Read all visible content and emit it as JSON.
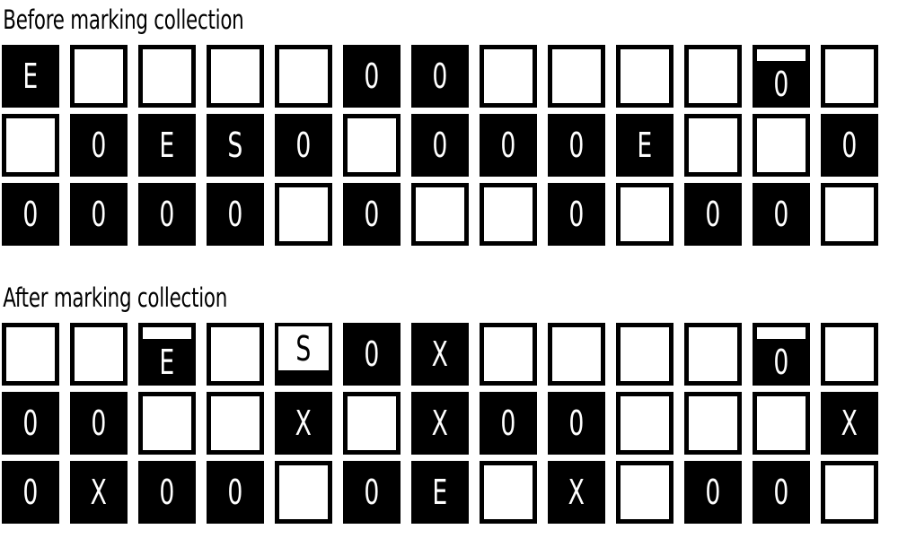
{
  "page": {
    "background_color": "#ffffff",
    "foreground_color": "#000000"
  },
  "sections": [
    {
      "id": "before",
      "title": "Before marking collection",
      "rows": [
        [
          {
            "state": "filled",
            "label": "E"
          },
          {
            "state": "empty",
            "label": ""
          },
          {
            "state": "empty",
            "label": ""
          },
          {
            "state": "empty",
            "label": ""
          },
          {
            "state": "empty",
            "label": ""
          },
          {
            "state": "filled",
            "label": "0"
          },
          {
            "state": "filled",
            "label": "0"
          },
          {
            "state": "empty",
            "label": ""
          },
          {
            "state": "empty",
            "label": ""
          },
          {
            "state": "empty",
            "label": ""
          },
          {
            "state": "empty",
            "label": ""
          },
          {
            "state": "marked",
            "label": "0"
          },
          {
            "state": "empty",
            "label": ""
          }
        ],
        [
          {
            "state": "empty",
            "label": ""
          },
          {
            "state": "filled",
            "label": "0"
          },
          {
            "state": "filled",
            "label": "E"
          },
          {
            "state": "filled",
            "label": "S"
          },
          {
            "state": "filled",
            "label": "0"
          },
          {
            "state": "empty",
            "label": ""
          },
          {
            "state": "filled",
            "label": "0"
          },
          {
            "state": "filled",
            "label": "0"
          },
          {
            "state": "filled",
            "label": "0"
          },
          {
            "state": "filled",
            "label": "E"
          },
          {
            "state": "empty",
            "label": ""
          },
          {
            "state": "empty",
            "label": ""
          },
          {
            "state": "filled",
            "label": "0"
          }
        ],
        [
          {
            "state": "filled",
            "label": "0"
          },
          {
            "state": "filled",
            "label": "0"
          },
          {
            "state": "filled",
            "label": "0"
          },
          {
            "state": "filled",
            "label": "0"
          },
          {
            "state": "empty",
            "label": ""
          },
          {
            "state": "filled",
            "label": "0"
          },
          {
            "state": "empty",
            "label": ""
          },
          {
            "state": "empty",
            "label": ""
          },
          {
            "state": "filled",
            "label": "0"
          },
          {
            "state": "empty",
            "label": ""
          },
          {
            "state": "filled",
            "label": "0"
          },
          {
            "state": "filled",
            "label": "0"
          },
          {
            "state": "empty",
            "label": ""
          }
        ]
      ]
    },
    {
      "id": "after",
      "title": "After marking collection",
      "rows": [
        [
          {
            "state": "empty",
            "label": ""
          },
          {
            "state": "empty",
            "label": ""
          },
          {
            "state": "marked",
            "label": "E"
          },
          {
            "state": "empty",
            "label": ""
          },
          {
            "state": "inverted",
            "label": "S"
          },
          {
            "state": "filled",
            "label": "0"
          },
          {
            "state": "filled",
            "label": "X"
          },
          {
            "state": "empty",
            "label": ""
          },
          {
            "state": "empty",
            "label": ""
          },
          {
            "state": "empty",
            "label": ""
          },
          {
            "state": "empty",
            "label": ""
          },
          {
            "state": "marked",
            "label": "0"
          },
          {
            "state": "empty",
            "label": ""
          }
        ],
        [
          {
            "state": "filled",
            "label": "0"
          },
          {
            "state": "filled",
            "label": "0"
          },
          {
            "state": "empty",
            "label": ""
          },
          {
            "state": "empty",
            "label": ""
          },
          {
            "state": "filled",
            "label": "X"
          },
          {
            "state": "empty",
            "label": ""
          },
          {
            "state": "filled",
            "label": "X"
          },
          {
            "state": "filled",
            "label": "0"
          },
          {
            "state": "filled",
            "label": "0"
          },
          {
            "state": "empty",
            "label": ""
          },
          {
            "state": "empty",
            "label": ""
          },
          {
            "state": "empty",
            "label": ""
          },
          {
            "state": "filled",
            "label": "X"
          }
        ],
        [
          {
            "state": "filled",
            "label": "0"
          },
          {
            "state": "filled",
            "label": "X"
          },
          {
            "state": "filled",
            "label": "0"
          },
          {
            "state": "filled",
            "label": "0"
          },
          {
            "state": "empty",
            "label": ""
          },
          {
            "state": "filled",
            "label": "0"
          },
          {
            "state": "filled",
            "label": "E"
          },
          {
            "state": "empty",
            "label": ""
          },
          {
            "state": "filled",
            "label": "X"
          },
          {
            "state": "empty",
            "label": ""
          },
          {
            "state": "filled",
            "label": "0"
          },
          {
            "state": "filled",
            "label": "0"
          },
          {
            "state": "empty",
            "label": ""
          }
        ]
      ]
    }
  ]
}
